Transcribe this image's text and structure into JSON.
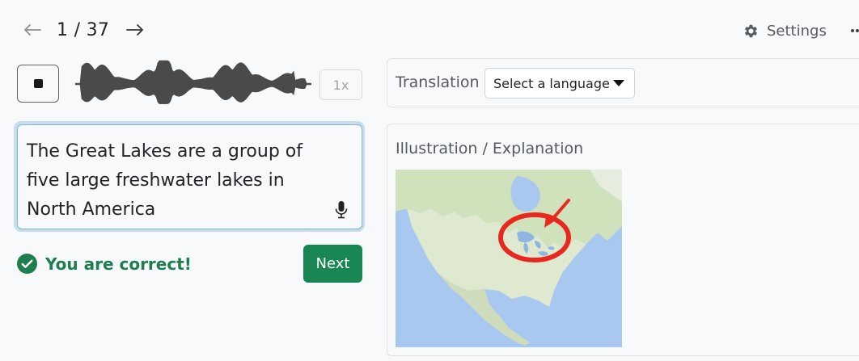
{
  "nav": {
    "counter": "1 / 37"
  },
  "header": {
    "settings_label": "Settings"
  },
  "player": {
    "speed_label": "1x"
  },
  "answer": {
    "text": "The Great Lakes are a group of five large freshwater lakes in North America"
  },
  "result": {
    "message": "You are correct!",
    "color": "#1e7e4f"
  },
  "buttons": {
    "next_label": "Next",
    "next_color": "#198754"
  },
  "translation": {
    "label": "Translation",
    "select_value": "Select a language"
  },
  "illustration": {
    "label": "Illustration / Explanation"
  }
}
